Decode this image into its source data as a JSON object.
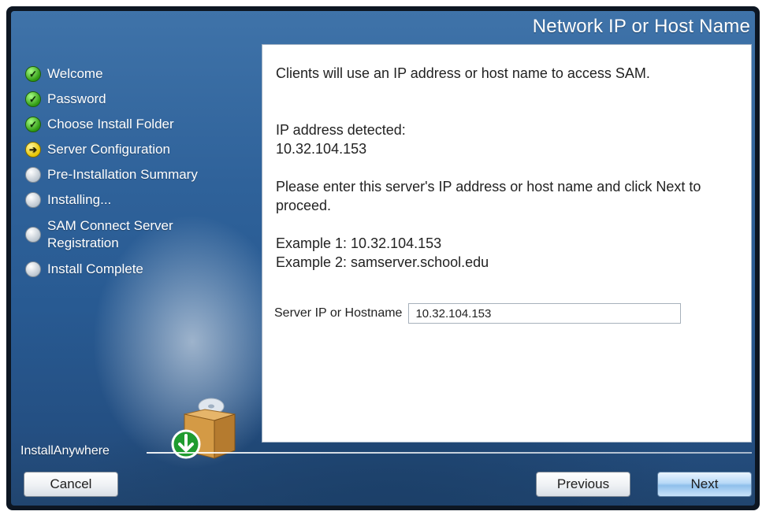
{
  "window": {
    "title": "Network IP or Host Name",
    "brand": "InstallAnywhere"
  },
  "sidebar": {
    "steps": [
      {
        "label": "Welcome",
        "status": "done",
        "icon": "check-icon"
      },
      {
        "label": "Password",
        "status": "done",
        "icon": "check-icon"
      },
      {
        "label": "Choose Install Folder",
        "status": "done",
        "icon": "check-icon"
      },
      {
        "label": "Server Configuration",
        "status": "current",
        "icon": "arrow-right-icon"
      },
      {
        "label": "Pre-Installation Summary",
        "status": "pending",
        "icon": "empty-circle-icon"
      },
      {
        "label": "Installing...",
        "status": "pending",
        "icon": "empty-circle-icon"
      },
      {
        "label": "SAM Connect Server Registration",
        "status": "pending",
        "icon": "empty-circle-icon"
      },
      {
        "label": "Install Complete",
        "status": "pending",
        "icon": "empty-circle-icon"
      }
    ]
  },
  "content": {
    "intro": "Clients will use an IP address or host name to access SAM.",
    "detected_label": "IP address detected:",
    "detected_value": "10.32.104.153",
    "instruction": "Please enter this server's IP address or host name and click Next to proceed.",
    "example1": "Example 1: 10.32.104.153",
    "example2": "Example 2: samserver.school.edu",
    "field_label": "Server IP or Hostname",
    "field_value": "10.32.104.153"
  },
  "buttons": {
    "cancel": "Cancel",
    "previous": "Previous",
    "next": "Next"
  },
  "colors": {
    "panel_blue": "#2f629a",
    "done": "#2f9a11",
    "current": "#e7c400",
    "pending": "#b9c3cd"
  }
}
